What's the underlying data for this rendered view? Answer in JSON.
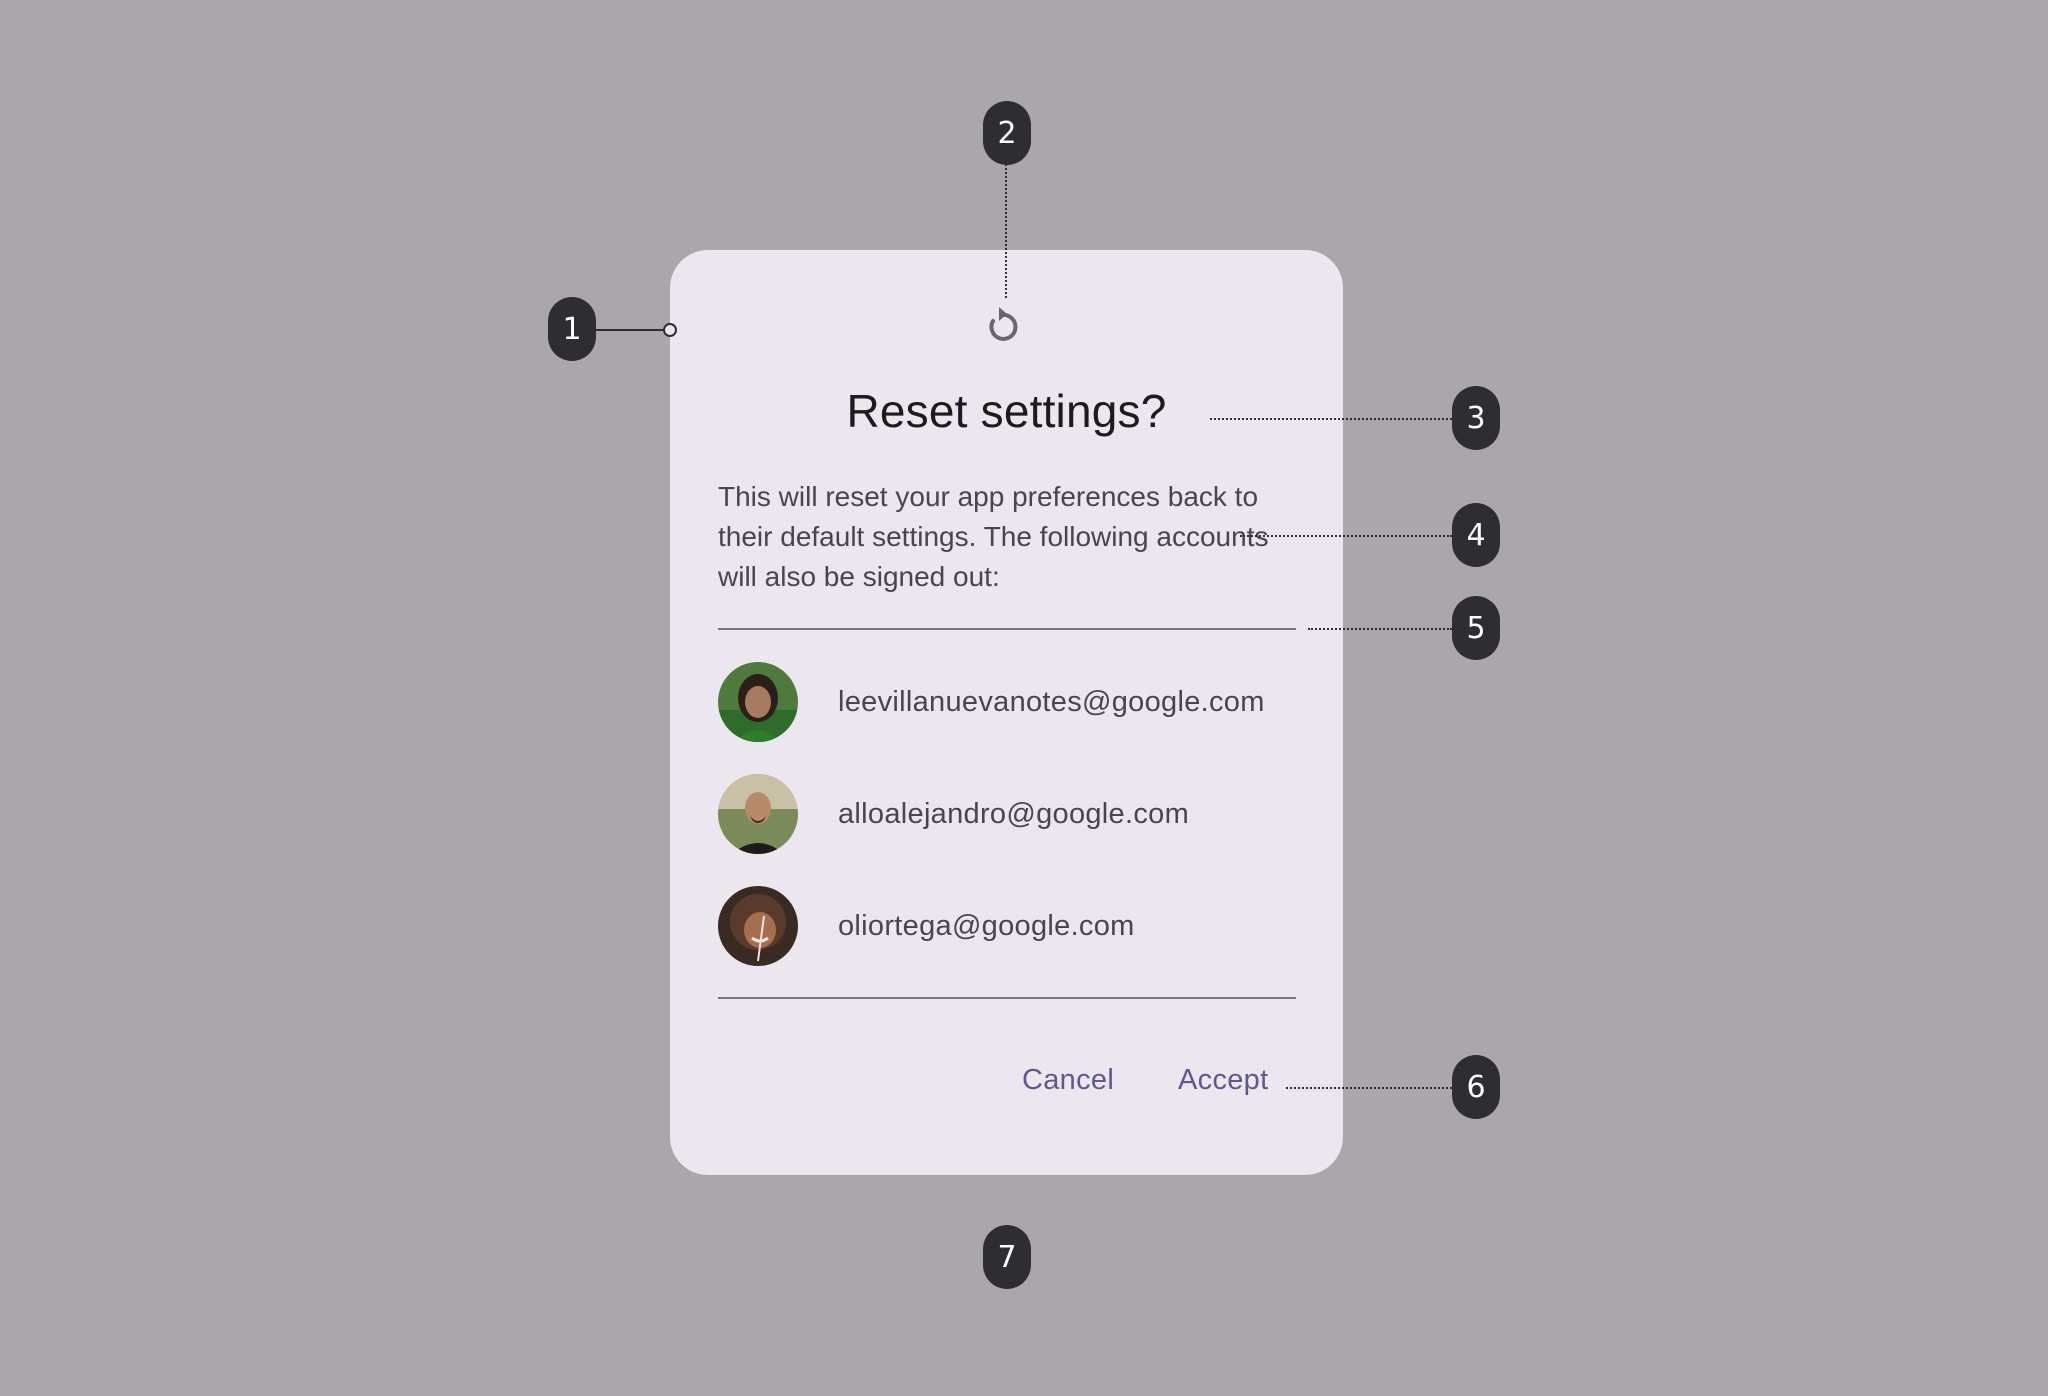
{
  "dialog": {
    "title": "Reset settings?",
    "body": "This will reset your app preferences back to their default settings. The following accounts will also be signed out:",
    "accounts": [
      {
        "email": "leevillanuevanotes@google.com"
      },
      {
        "email": "alloalejandro@google.com"
      },
      {
        "email": "oliortega@google.com"
      }
    ],
    "actions": {
      "cancel": "Cancel",
      "accept": "Accept"
    }
  },
  "annotations": [
    "1",
    "2",
    "3",
    "4",
    "5",
    "6",
    "7"
  ],
  "icons": {
    "header": "reset-icon"
  },
  "colors": {
    "background": "#aaa6ab",
    "surface": "#ece6ee",
    "action_text": "#65558f",
    "badge": "#2e2d31"
  }
}
